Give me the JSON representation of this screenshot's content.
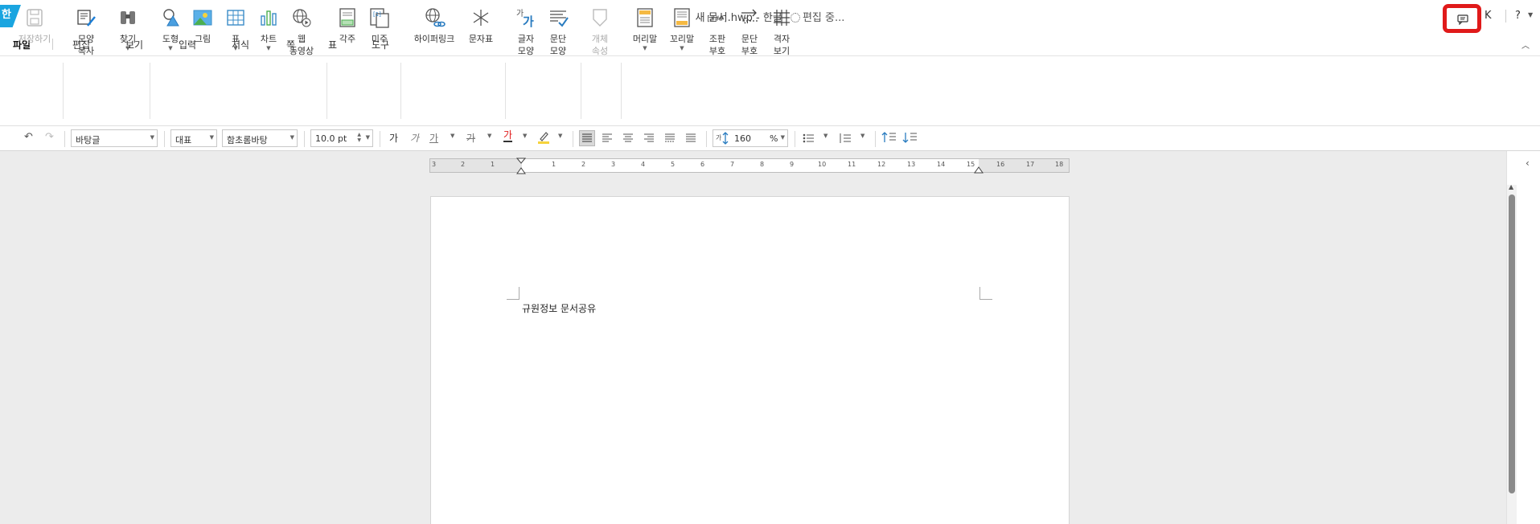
{
  "titlebar": {
    "logo": "한",
    "title": "새 문서.hwp - 한글",
    "status": "편집 중...",
    "user": "K",
    "help": "?"
  },
  "menu": [
    "파일",
    "편집",
    "보기",
    "입력",
    "서식",
    "쪽",
    "표",
    "도구"
  ],
  "ribbon": {
    "save": "저장하기",
    "shape_copy": [
      "모양",
      "복사"
    ],
    "find": "찾기",
    "drawing": "도형",
    "picture": "그림",
    "table": "표",
    "chart": "차트",
    "web_video": [
      "웹",
      "동영상"
    ],
    "footnote": "각주",
    "endnote": "미주",
    "hyperlink": "하이퍼링크",
    "char_map": "문자표",
    "char_shape": [
      "글자",
      "모양"
    ],
    "para_shape": [
      "문단",
      "모양"
    ],
    "obj_prop": [
      "개체",
      "속성"
    ],
    "header": "머리말",
    "footer": "꼬리말",
    "assembly_code": [
      "조판",
      "부호"
    ],
    "para_mark": [
      "문단",
      "부호"
    ],
    "grid_view": [
      "격자",
      "보기"
    ],
    "header_icon_text": "[###]",
    "char_icon_text": "가",
    "footnote_icon_text": "[1]"
  },
  "format": {
    "style": "바탕글",
    "lang": "대표",
    "font": "함초롬바탕",
    "size": "10.0",
    "unit": "pt",
    "bold": "가",
    "italic": "가",
    "underline": "가",
    "strike": "가",
    "color": "가",
    "line_spacing": "160",
    "percent": "%"
  },
  "ruler": [
    "3",
    "2",
    "1",
    "1",
    "2",
    "3",
    "4",
    "5",
    "6",
    "7",
    "8",
    "9",
    "10",
    "11",
    "12",
    "13",
    "14",
    "15",
    "16",
    "17",
    "18"
  ],
  "document": {
    "text": "규원정보 문서공유"
  },
  "colors": {
    "highlight": "#e01a1a",
    "logo": "#1aa5e0"
  }
}
